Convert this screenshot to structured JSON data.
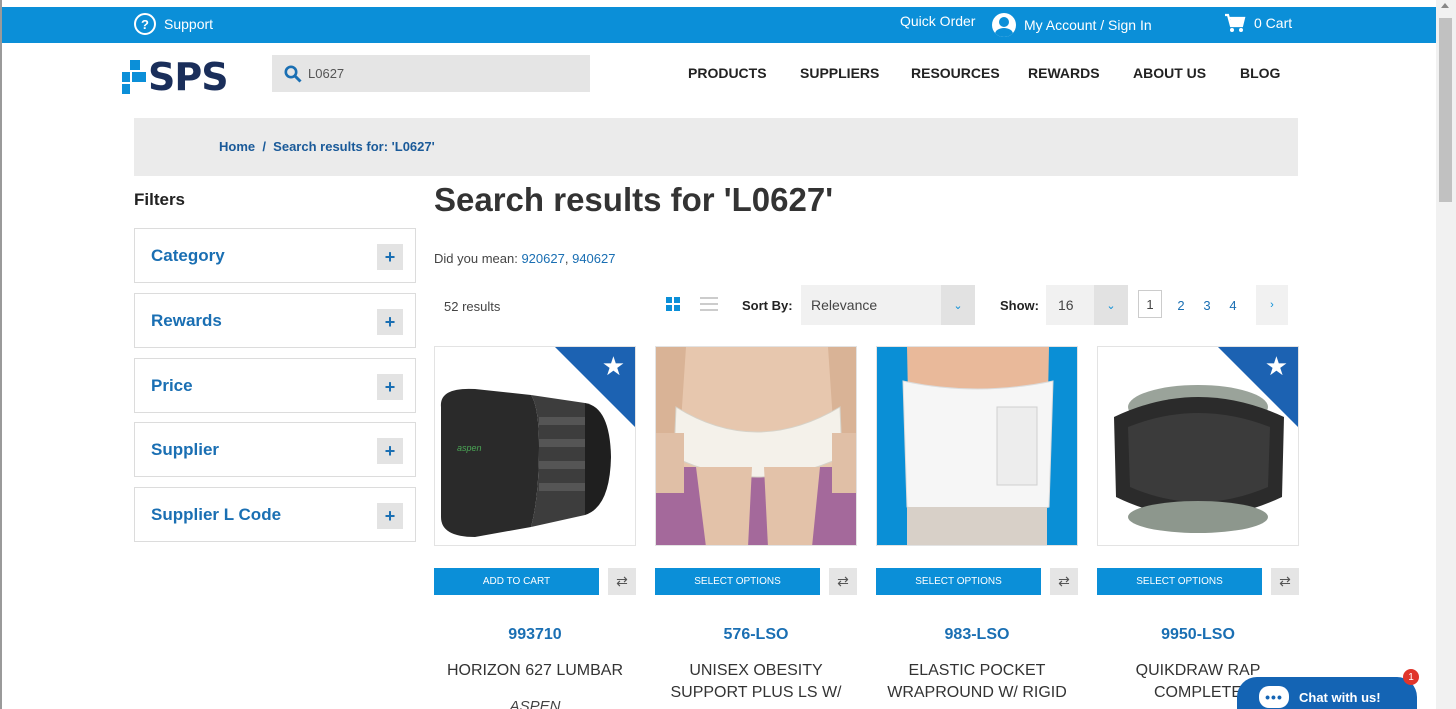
{
  "topbar": {
    "support_label": "Support",
    "quick_order_label": "Quick Order",
    "account_label": "My Account / Sign In",
    "cart_label": "0 Cart"
  },
  "header": {
    "logo_text": "SPS",
    "search_value": "L0627",
    "nav": [
      "PRODUCTS",
      "SUPPLIERS",
      "RESOURCES",
      "REWARDS",
      "ABOUT US",
      "BLOG"
    ]
  },
  "breadcrumb": {
    "text": "Home  /  Search results for: 'L0627'"
  },
  "filters": {
    "title": "Filters",
    "items": [
      "Category",
      "Rewards",
      "Price",
      "Supplier",
      "Supplier L Code"
    ],
    "expand_symbol": "+"
  },
  "results": {
    "title": "Search results for 'L0627'",
    "did_you_mean_label": "Did you mean:",
    "suggestion_1": "920627",
    "suggestion_sep": ",",
    "suggestion_2": "940627",
    "count_label": "52 results",
    "sort_label": "Sort By:",
    "sort_value": "Relevance",
    "show_label": "Show:",
    "show_value": "16",
    "pages": [
      "1",
      "2",
      "3",
      "4"
    ],
    "current_page": "1",
    "next_symbol": "›",
    "caret_symbol": "⌄"
  },
  "products": [
    {
      "sku": "993710",
      "name": "HORIZON 627 LUMBAR",
      "brand": "ASPEN",
      "button": "ADD TO CART",
      "badge": true
    },
    {
      "sku": "576-LSO",
      "name": "UNISEX OBESITY SUPPORT PLUS LS W/",
      "brand": "",
      "button": "SELECT OPTIONS",
      "badge": false
    },
    {
      "sku": "983-LSO",
      "name": "ELASTIC POCKET WRAPROUND W/ RIGID",
      "brand": "",
      "button": "SELECT OPTIONS",
      "badge": false
    },
    {
      "sku": "9950-LSO",
      "name": "QUIKDRAW RAP COMPLETE",
      "brand": "",
      "button": "SELECT OPTIONS",
      "badge": true
    }
  ],
  "compare_symbol": "⇄",
  "chat": {
    "label": "Chat with us!",
    "badge": "1",
    "icon_text": "•••"
  },
  "colors": {
    "brand_blue": "#0b8fd8",
    "link_blue": "#1a6fb3",
    "badge_blue": "#1c62b2",
    "logo_navy": "#1a2e5a",
    "chat_blue": "#1464b4",
    "alert_red": "#e0352b"
  },
  "icons": [
    "question-circle-icon",
    "account-icon",
    "cart-icon",
    "search-icon",
    "grid-view-icon",
    "list-view-icon",
    "star-badge-icon",
    "compare-icon",
    "chat-icon"
  ]
}
